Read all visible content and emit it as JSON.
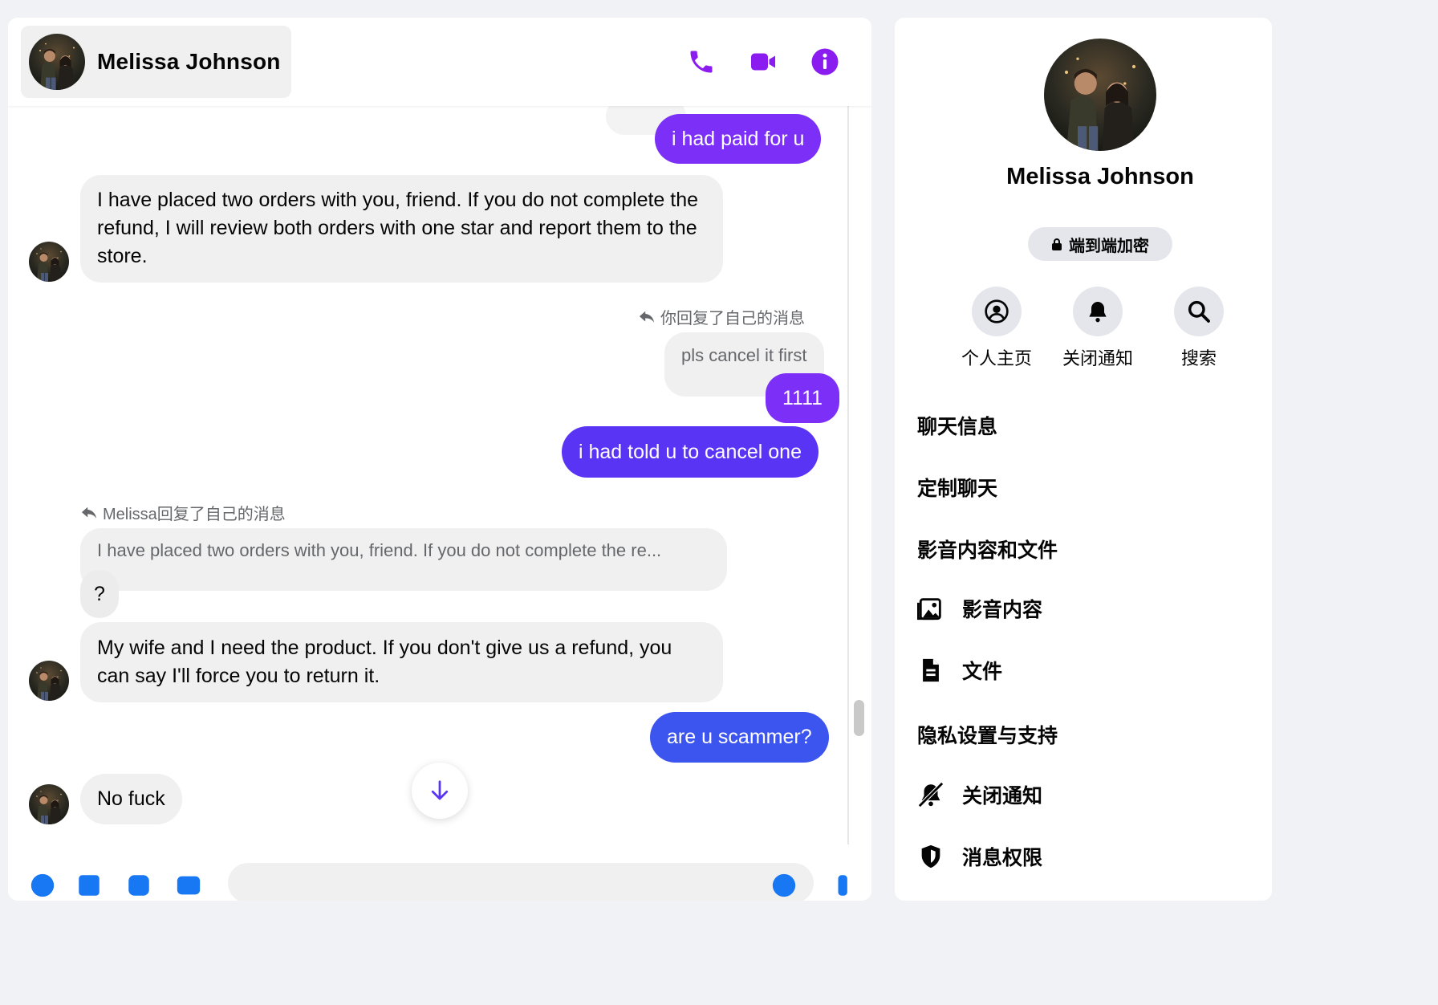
{
  "contact": {
    "name": "Melissa Johnson"
  },
  "header": {
    "icons": [
      "phone-icon",
      "video-icon",
      "info-icon"
    ],
    "accent": "#7b2ff7"
  },
  "messages": {
    "m1": "i had paid for u",
    "m2": "I have placed two orders with you, friend. If you do not complete the refund, I will review both orders with one star and report them to the store.",
    "reply_self_label": "你回复了自己的消息",
    "quoted_self": "pls cancel it first",
    "m3": "1111",
    "m4": "i had told u to cancel one",
    "reply_melissa_label": "Melissa回复了自己的消息",
    "quoted_melissa": "I have placed two orders with you, friend. If you do not complete the re...",
    "m5": "?",
    "m6": "My wife and I need the product. If you don't give us a refund, you can say I'll force you to return it.",
    "m7": "are u scammer?",
    "m8": "No fuck"
  },
  "info": {
    "name": "Melissa Johnson",
    "encryption": "端到端加密",
    "actions": [
      {
        "label": "个人主页",
        "icon": "profile-icon"
      },
      {
        "label": "关闭通知",
        "icon": "bell-icon"
      },
      {
        "label": "搜索",
        "icon": "search-icon"
      }
    ],
    "sections": {
      "chat_info": "聊天信息",
      "customize": "定制聊天",
      "media_files": "影音内容和文件",
      "media": "影音内容",
      "files": "文件",
      "privacy": "隐私设置与支持",
      "mute": "关闭通知",
      "permissions": "消息权限"
    }
  },
  "colors": {
    "purple": "#7b2ff7",
    "blue": "#3b4ef0",
    "bubble_gray": "#f0f0f0"
  }
}
